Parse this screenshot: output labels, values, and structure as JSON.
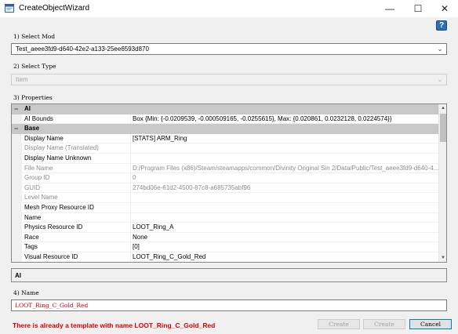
{
  "window": {
    "title": "CreateObjectWizard",
    "minimize_glyph": "—",
    "maximize_glyph": "☐",
    "close_glyph": "✕",
    "help_glyph": "?"
  },
  "select_mod": {
    "label": "1) Select Mod",
    "value": "Test_aeee3fd9-d640-42e2-a133-25ee6593d870",
    "arrow": "⌄"
  },
  "select_type": {
    "label": "2) Select Type",
    "value": "Item",
    "arrow": "⌄"
  },
  "properties": {
    "label": "3) Properties",
    "categories": [
      {
        "name": "AI",
        "toggle": "−",
        "rows": [
          {
            "name": "AI Bounds",
            "value": "Box {Min: {-0.0209539, -0.000509165, -0.0255615}, Max: {0.020861, 0.0232128, 0.0224574}}",
            "disabled": false
          }
        ]
      },
      {
        "name": "Base",
        "toggle": "−",
        "rows": [
          {
            "name": "Display Name",
            "value": "[STATS] ARM_Ring",
            "disabled": false
          },
          {
            "name": "Display Name (Translated)",
            "value": "",
            "disabled": true
          },
          {
            "name": "Display Name Unknown",
            "value": "",
            "disabled": false
          },
          {
            "name": "File Name",
            "value": "D:/Program Files (x86)/Steam/steamapps/common/Divinity Original Sin 2/Data/Public/Test_aeee3fd9-d640-4...",
            "disabled": true
          },
          {
            "name": "Group ID",
            "value": "0",
            "disabled": true
          },
          {
            "name": "GUID",
            "value": "274bd06e-61d2-4500-87c8-a685735abf96",
            "disabled": true
          },
          {
            "name": "Level Name",
            "value": "",
            "disabled": true
          },
          {
            "name": "Mesh Proxy Resource ID",
            "value": "",
            "disabled": false
          },
          {
            "name": "Name",
            "value": "",
            "disabled": false
          },
          {
            "name": "Physics Resource ID",
            "value": "LOOT_Ring_A",
            "disabled": false
          },
          {
            "name": "Race",
            "value": "None",
            "disabled": false
          },
          {
            "name": "Tags",
            "value": "[0]",
            "disabled": false
          },
          {
            "name": "Visual Resource ID",
            "value": "LOOT_Ring_C_Gold_Red",
            "disabled": false
          }
        ]
      }
    ],
    "scroll_up": "▲",
    "scroll_down": "▼",
    "description_title": "AI"
  },
  "name_field": {
    "label": "4) Name",
    "value": "LOOT_Ring_C_Gold_Red"
  },
  "error_message": "There is already a template with name LOOT_Ring_C_Gold_Red",
  "buttons": {
    "create1": "Create",
    "create2": "Create",
    "cancel": "Cancel"
  }
}
